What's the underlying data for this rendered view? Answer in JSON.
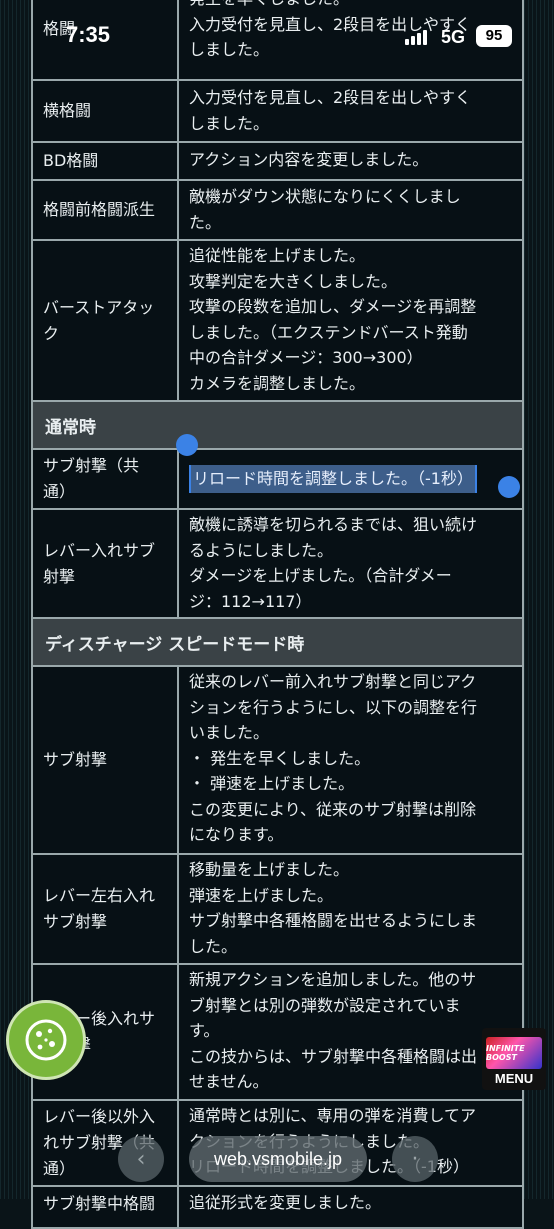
{
  "status_bar": {
    "time": "7:35",
    "network": "5G",
    "battery": "95"
  },
  "rows_top": [
    {
      "label": "格闘",
      "lines": [
        "発生を早くしました。",
        "入力受付を見直し、2段目を出しやすく",
        "しました。"
      ]
    },
    {
      "label": "横格闘",
      "lines": [
        "入力受付を見直し、2段目を出しやすく",
        "しました。"
      ]
    },
    {
      "label": "BD格闘",
      "lines": [
        "アクション内容を変更しました。"
      ]
    },
    {
      "label": "格闘前格闘派生",
      "lines": [
        "敵機がダウン状態になりにくくしまし",
        "た。"
      ]
    },
    {
      "label": "バーストアタック",
      "lines": [
        "追従性能を上げました。",
        "攻撃判定を大きくしました。",
        "攻撃の段数を追加し、ダメージを再調整",
        "しました。（エクステンドバースト発動",
        "中の合計ダメージ：300→300）",
        "カメラを調整しました。"
      ]
    }
  ],
  "section_normal": "通常時",
  "rows_normal": [
    {
      "label": "サブ射撃（共通）",
      "lines": [
        "リロード時間を調整しました。（-1秒）"
      ]
    },
    {
      "label": "レバー入れサブ射撃",
      "lines": [
        "敵機に誘導を切られるまでは、狙い続け",
        "るようにしました。",
        "ダメージを上げました。（合計ダメー",
        "ジ：112→117）"
      ]
    }
  ],
  "section_discharge": "ディスチャージ スピードモード時",
  "rows_discharge": [
    {
      "label": "サブ射撃",
      "lines": [
        "従来のレバー前入れサブ射撃と同じアク",
        "ションを行うようにし、以下の調整を行",
        "いました。",
        "・ 発生を早くしました。",
        "・ 弾速を上げました。",
        "この変更により、従来のサブ射撃は削除",
        "になります。"
      ]
    },
    {
      "label": "レバー左右入れサブ射撃",
      "lines": [
        "移動量を上げました。",
        "弾速を上げました。",
        "サブ射撃中各種格闘を出せるようにしま",
        "した。"
      ]
    },
    {
      "label": "レバー後入れサブ射撃",
      "lines": [
        "新規アクションを追加しました。他のサ",
        "ブ射撃とは別の弾数が設定されていま",
        "す。",
        "この技からは、サブ射撃中各種格闘は出",
        "せません。"
      ]
    },
    {
      "label": "レバー後以外入れサブ射撃（共通）",
      "lines": [
        "通常時とは別に、専用の弾を消費してア",
        "クションを行うようにしました。",
        "リロード時間を調整しました。（-1秒）"
      ]
    },
    {
      "label": "サブ射撃中格闘",
      "lines": [
        "追従形式を変更しました。"
      ]
    }
  ],
  "menu": {
    "label": "MENU",
    "logo_text": "INFINITE BOOST"
  },
  "browser": {
    "url": "web.vsmobile.jp"
  }
}
